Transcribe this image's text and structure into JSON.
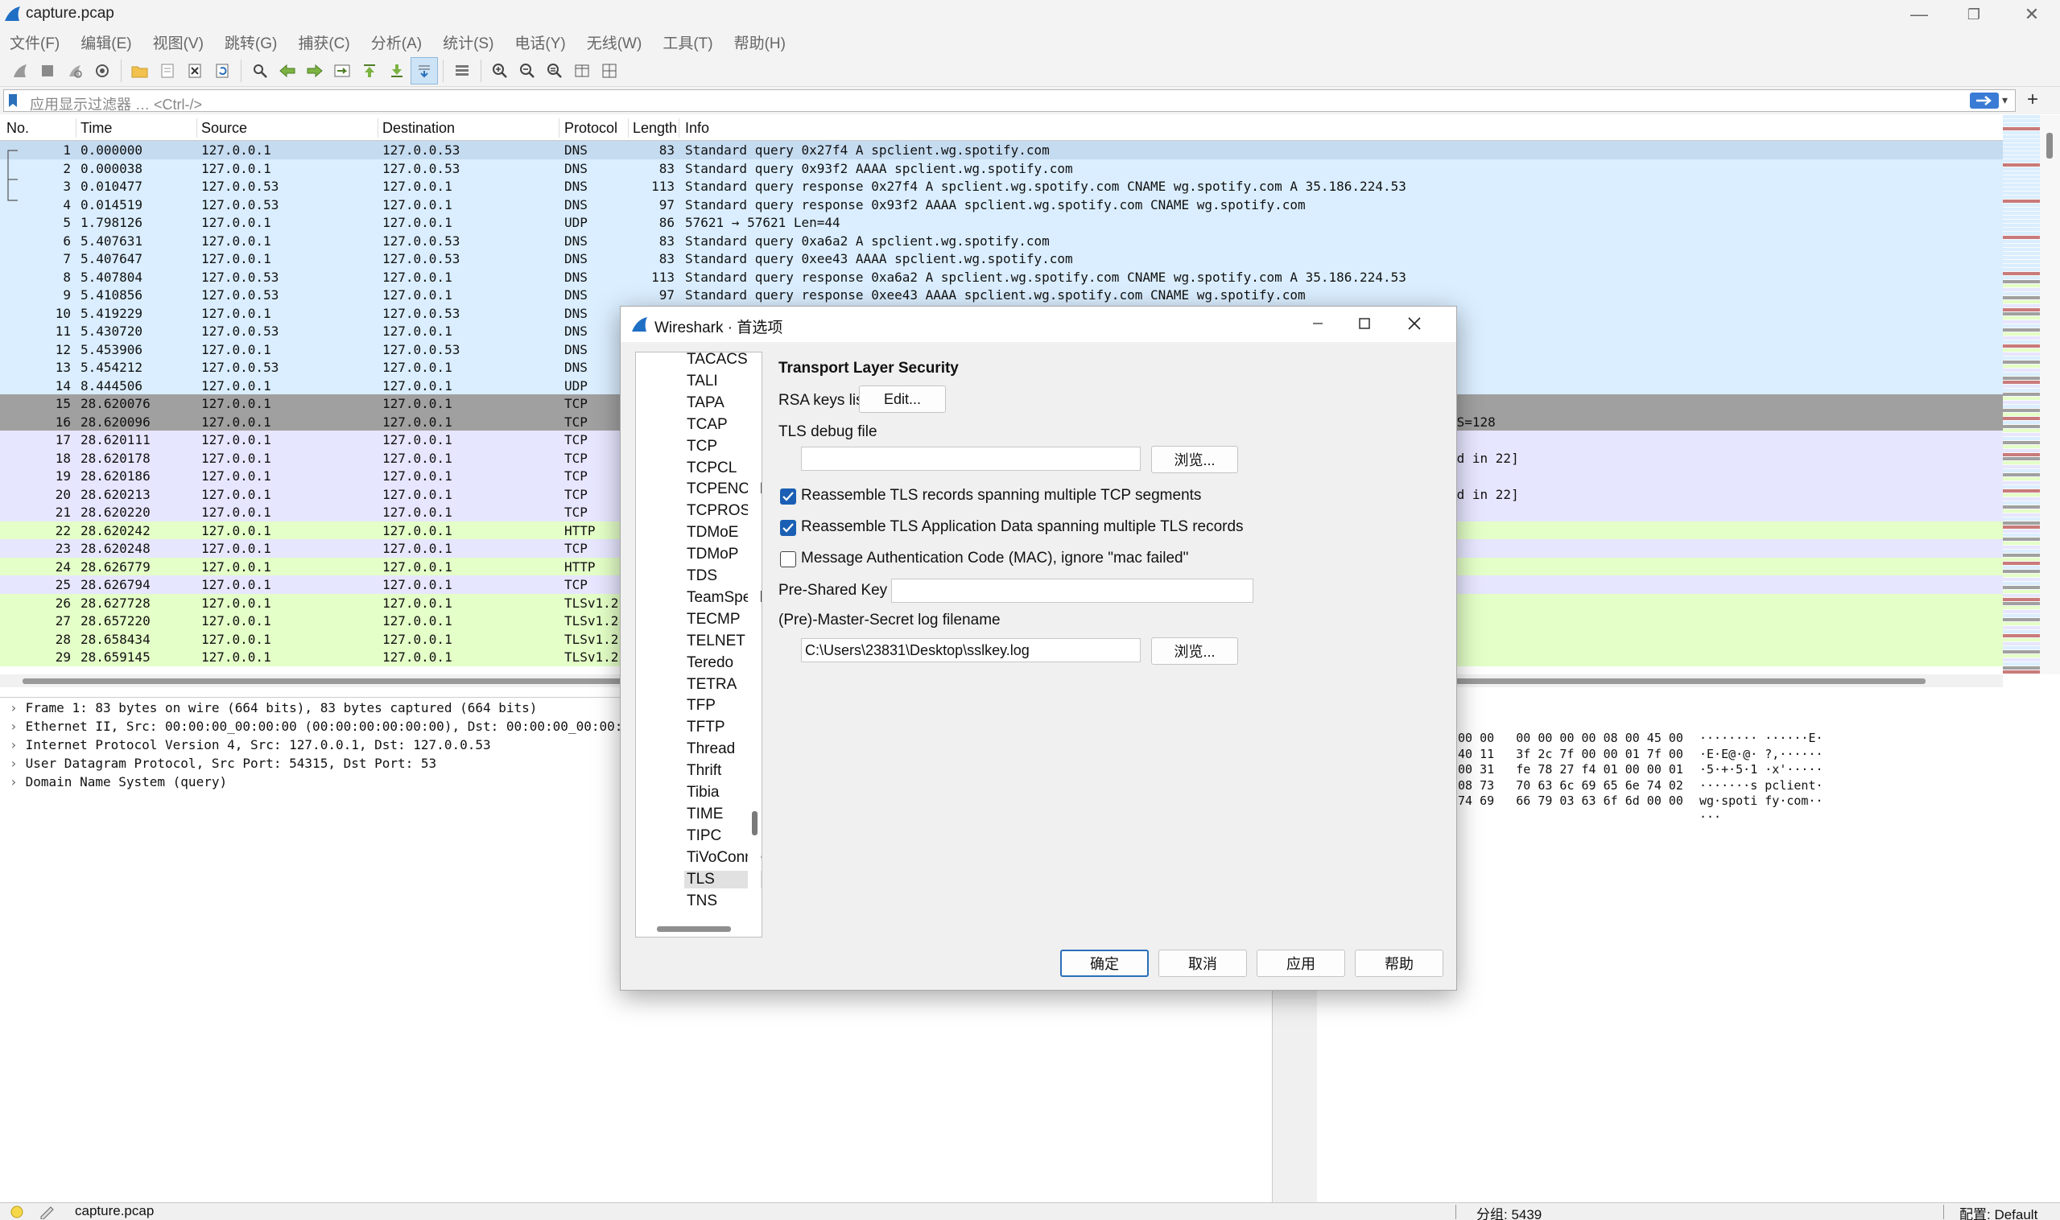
{
  "window": {
    "title": "capture.pcap",
    "controls": [
      "—",
      "❐",
      "✕"
    ]
  },
  "menu": [
    "文件(F)",
    "编辑(E)",
    "视图(V)",
    "跳转(G)",
    "捕获(C)",
    "分析(A)",
    "统计(S)",
    "电话(Y)",
    "无线(W)",
    "工具(T)",
    "帮助(H)"
  ],
  "filter": {
    "placeholder": "应用显示过滤器 … <Ctrl-/>"
  },
  "packet_list": {
    "columns": [
      "No.",
      "Time",
      "Source",
      "Destination",
      "Protocol",
      "Length",
      "Info"
    ],
    "rows": [
      {
        "no": "1",
        "time": "0.000000",
        "src": "127.0.0.1",
        "dst": "127.0.0.53",
        "proto": "DNS",
        "len": "83",
        "info": "Standard query 0x27f4 A spclient.wg.spotify.com",
        "bg": "#c5dbf0"
      },
      {
        "no": "2",
        "time": "0.000038",
        "src": "127.0.0.1",
        "dst": "127.0.0.53",
        "proto": "DNS",
        "len": "83",
        "info": "Standard query 0x93f2 AAAA spclient.wg.spotify.com",
        "bg": "#daeeff"
      },
      {
        "no": "3",
        "time": "0.010477",
        "src": "127.0.0.53",
        "dst": "127.0.0.1",
        "proto": "DNS",
        "len": "113",
        "info": "Standard query response 0x27f4 A spclient.wg.spotify.com CNAME wg.spotify.com A 35.186.224.53",
        "bg": "#daeeff"
      },
      {
        "no": "4",
        "time": "0.014519",
        "src": "127.0.0.53",
        "dst": "127.0.0.1",
        "proto": "DNS",
        "len": "97",
        "info": "Standard query response 0x93f2 AAAA spclient.wg.spotify.com CNAME wg.spotify.com",
        "bg": "#daeeff"
      },
      {
        "no": "5",
        "time": "1.798126",
        "src": "127.0.0.1",
        "dst": "127.0.0.1",
        "proto": "UDP",
        "len": "86",
        "info": "57621 → 57621 Len=44",
        "bg": "#daeeff"
      },
      {
        "no": "6",
        "time": "5.407631",
        "src": "127.0.0.1",
        "dst": "127.0.0.53",
        "proto": "DNS",
        "len": "83",
        "info": "Standard query 0xa6a2 A spclient.wg.spotify.com",
        "bg": "#daeeff"
      },
      {
        "no": "7",
        "time": "5.407647",
        "src": "127.0.0.1",
        "dst": "127.0.0.53",
        "proto": "DNS",
        "len": "83",
        "info": "Standard query 0xee43 AAAA spclient.wg.spotify.com",
        "bg": "#daeeff"
      },
      {
        "no": "8",
        "time": "5.407804",
        "src": "127.0.0.53",
        "dst": "127.0.0.1",
        "proto": "DNS",
        "len": "113",
        "info": "Standard query response 0xa6a2 A spclient.wg.spotify.com CNAME wg.spotify.com A 35.186.224.53",
        "bg": "#daeeff"
      },
      {
        "no": "9",
        "time": "5.410856",
        "src": "127.0.0.53",
        "dst": "127.0.0.1",
        "proto": "DNS",
        "len": "97",
        "info": "Standard query response 0xee43 AAAA spclient.wg.spotify.com CNAME wg.spotify.com",
        "bg": "#daeeff"
      },
      {
        "no": "10",
        "time": "5.419229",
        "src": "127.0.0.1",
        "dst": "127.0.0.53",
        "proto": "DNS",
        "len": "",
        "info": "",
        "bg": "#daeeff"
      },
      {
        "no": "11",
        "time": "5.430720",
        "src": "127.0.0.53",
        "dst": "127.0.0.1",
        "proto": "DNS",
        "len": "",
        "info": "",
        "bg": "#daeeff"
      },
      {
        "no": "12",
        "time": "5.453906",
        "src": "127.0.0.1",
        "dst": "127.0.0.53",
        "proto": "DNS",
        "len": "",
        "info": "",
        "bg": "#daeeff"
      },
      {
        "no": "13",
        "time": "5.454212",
        "src": "127.0.0.53",
        "dst": "127.0.0.1",
        "proto": "DNS",
        "len": "",
        "info": "",
        "bg": "#daeeff"
      },
      {
        "no": "14",
        "time": "8.444506",
        "src": "127.0.0.1",
        "dst": "127.0.0.1",
        "proto": "UDP",
        "len": "",
        "info": "",
        "bg": "#daeeff"
      },
      {
        "no": "15",
        "time": "28.620076",
        "src": "127.0.0.1",
        "dst": "127.0.0.1",
        "proto": "TCP",
        "len": "",
        "info": "",
        "bg": "#a0a0a0"
      },
      {
        "no": "16",
        "time": "28.620096",
        "src": "127.0.0.1",
        "dst": "127.0.0.1",
        "proto": "TCP",
        "len": "",
        "info": "WS=128",
        "bg": "#a0a0a0"
      },
      {
        "no": "17",
        "time": "28.620111",
        "src": "127.0.0.1",
        "dst": "127.0.0.1",
        "proto": "TCP",
        "len": "",
        "info": "",
        "bg": "#e7e6ff"
      },
      {
        "no": "18",
        "time": "28.620178",
        "src": "127.0.0.1",
        "dst": "127.0.0.1",
        "proto": "TCP",
        "len": "",
        "info": "ed in 22]",
        "bg": "#e7e6ff"
      },
      {
        "no": "19",
        "time": "28.620186",
        "src": "127.0.0.1",
        "dst": "127.0.0.1",
        "proto": "TCP",
        "len": "",
        "info": "",
        "bg": "#e7e6ff"
      },
      {
        "no": "20",
        "time": "28.620213",
        "src": "127.0.0.1",
        "dst": "127.0.0.1",
        "proto": "TCP",
        "len": "",
        "info": "ed in 22]",
        "bg": "#e7e6ff"
      },
      {
        "no": "21",
        "time": "28.620220",
        "src": "127.0.0.1",
        "dst": "127.0.0.1",
        "proto": "TCP",
        "len": "",
        "info": "",
        "bg": "#e7e6ff"
      },
      {
        "no": "22",
        "time": "28.620242",
        "src": "127.0.0.1",
        "dst": "127.0.0.1",
        "proto": "HTTP",
        "len": "",
        "info": "",
        "bg": "#e4ffc7"
      },
      {
        "no": "23",
        "time": "28.620248",
        "src": "127.0.0.1",
        "dst": "127.0.0.1",
        "proto": "TCP",
        "len": "",
        "info": "",
        "bg": "#e7e6ff"
      },
      {
        "no": "24",
        "time": "28.626779",
        "src": "127.0.0.1",
        "dst": "127.0.0.1",
        "proto": "HTTP",
        "len": "",
        "info": "",
        "bg": "#e4ffc7"
      },
      {
        "no": "25",
        "time": "28.626794",
        "src": "127.0.0.1",
        "dst": "127.0.0.1",
        "proto": "TCP",
        "len": "",
        "info": "",
        "bg": "#e7e6ff"
      },
      {
        "no": "26",
        "time": "28.627728",
        "src": "127.0.0.1",
        "dst": "127.0.0.1",
        "proto": "TLSv1.2",
        "len": "",
        "info": "",
        "bg": "#e4ffc7"
      },
      {
        "no": "27",
        "time": "28.657220",
        "src": "127.0.0.1",
        "dst": "127.0.0.1",
        "proto": "TLSv1.2",
        "len": "",
        "info": "",
        "bg": "#e4ffc7"
      },
      {
        "no": "28",
        "time": "28.658434",
        "src": "127.0.0.1",
        "dst": "127.0.0.1",
        "proto": "TLSv1.2",
        "len": "",
        "info": "",
        "bg": "#e4ffc7"
      },
      {
        "no": "29",
        "time": "28.659145",
        "src": "127.0.0.1",
        "dst": "127.0.0.1",
        "proto": "TLSv1.2",
        "len": "",
        "info": "",
        "bg": "#e4ffc7"
      }
    ]
  },
  "details": [
    "Frame 1: 83 bytes on wire (664 bits), 83 bytes captured (664 bits)",
    "Ethernet II, Src: 00:00:00_00:00:00 (00:00:00:00:00:00), Dst: 00:00:00_00:00:00 (",
    "Internet Protocol Version 4, Src: 127.0.0.1, Dst: 127.0.0.53",
    "User Datagram Protocol, Src Port: 54315, Dst Port: 53",
    "Domain Name System (query)"
  ],
  "bytes": {
    "hex": [
      "00 00   00 00 00 00 08 00 45 00",
      "40 11   3f 2c 7f 00 00 01 7f 00",
      "00 31   fe 78 27 f4 01 00 00 01",
      "08 73   70 63 6c 69 65 6e 74 02",
      "74 69   66 79 03 63 6f 6d 00 00"
    ],
    "ascii": [
      "········ ······E·",
      "·E·E@·@· ?,······",
      "·5·+·5·1 ·x'·····",
      "·······s pclient·",
      "wg·spoti fy·com··",
      "···"
    ]
  },
  "status": {
    "file": "capture.pcap",
    "packets": "分组: 5439",
    "profile": "配置: Default"
  },
  "dialog": {
    "title": "Wireshark · 首选项",
    "tree_items": [
      "TACACS+",
      "TALI",
      "TAPA",
      "TCAP",
      "TCP",
      "TCPCL",
      "TCPENCAP",
      "TCPROS",
      "TDMoE",
      "TDMoP",
      "TDS",
      "TeamSpeak",
      "TECMP",
      "TELNET",
      "Teredo",
      "TETRA",
      "TFP",
      "TFTP",
      "Thread",
      "Thrift",
      "Tibia",
      "TIME",
      "TIPC",
      "TiVoConne",
      "TLS",
      "TNS"
    ],
    "selected_item": "TLS",
    "section_title": "Transport Layer Security",
    "rsa_label": "RSA keys list",
    "rsa_edit": "Edit...",
    "debug_label": "TLS debug file",
    "debug_value": "",
    "browse": "浏览...",
    "check1": "Reassemble TLS records spanning multiple TCP segments",
    "check2": "Reassemble TLS Application Data spanning multiple TLS records",
    "check3": "Message Authentication Code (MAC), ignore \"mac failed\"",
    "check1_on": true,
    "check2_on": true,
    "check3_on": false,
    "psk_label": "Pre-Shared Key",
    "psk_value": "",
    "keylog_label": "(Pre)-Master-Secret log filename",
    "keylog_value": "C:\\Users\\23831\\Desktop\\sslkey.log",
    "ok": "确定",
    "cancel": "取消",
    "apply": "应用",
    "help": "帮助"
  },
  "colors": {
    "accent": "#1a5fb4",
    "dns_row": "#daeeff",
    "tcp_row": "#e7e6ff",
    "http_row": "#e4ffc7",
    "syn_row": "#a0a0a0"
  }
}
